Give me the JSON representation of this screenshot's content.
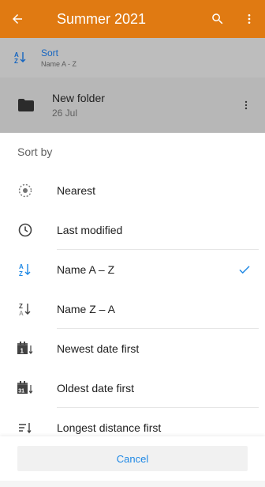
{
  "appbar": {
    "title": "Summer 2021",
    "icons": [
      "back-arrow-icon",
      "search-icon",
      "more-vert-icon"
    ],
    "color": "#e07a12"
  },
  "sort_bar": {
    "title": "Sort",
    "subtitle": "Name A - Z",
    "icon": "sort-az-icon"
  },
  "folder": {
    "name": "New folder",
    "date": "26 Jul",
    "icon": "folder-icon"
  },
  "sheet": {
    "title": "Sort by",
    "items": [
      {
        "label": "Nearest",
        "icon": "nearest-icon",
        "selected": false
      },
      {
        "label": "Last modified",
        "icon": "clock-icon",
        "selected": false
      },
      {
        "label": "Name A – Z",
        "icon": "sort-az-icon",
        "selected": true
      },
      {
        "label": "Name Z – A",
        "icon": "sort-za-icon",
        "selected": false
      },
      {
        "label": "Newest date first",
        "icon": "calendar-newest-icon",
        "selected": false
      },
      {
        "label": "Oldest date first",
        "icon": "calendar-oldest-icon",
        "selected": false
      },
      {
        "label": "Longest distance first",
        "icon": "distance-sort-icon",
        "selected": false
      }
    ],
    "cancel_label": "Cancel",
    "accent": "#1e88e5"
  }
}
